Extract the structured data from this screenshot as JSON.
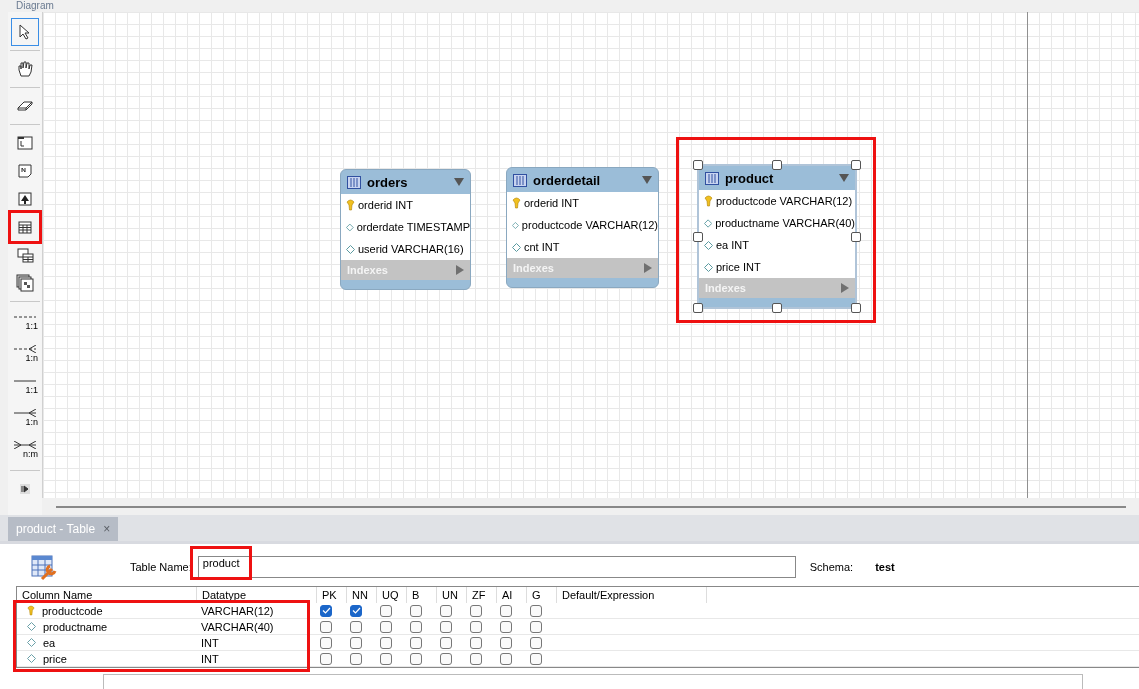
{
  "diagram": {
    "title": "Diagram"
  },
  "toolbar": [
    {
      "kind": "pointer",
      "selected": true,
      "highlighted": false
    },
    {
      "kind": "hand",
      "selected": false,
      "highlighted": false
    },
    {
      "kind": "eraser",
      "selected": false,
      "highlighted": false
    },
    {
      "kind": "layer",
      "selected": false,
      "highlighted": false
    },
    {
      "kind": "note",
      "selected": false,
      "highlighted": false
    },
    {
      "kind": "image",
      "selected": false,
      "highlighted": false
    },
    {
      "kind": "table",
      "selected": false,
      "highlighted": true
    },
    {
      "kind": "view",
      "selected": false,
      "highlighted": false
    },
    {
      "kind": "routine",
      "selected": false,
      "highlighted": false
    },
    {
      "kind": "relation",
      "dashed": true,
      "crow_right": false,
      "crow_left": false,
      "label": "1:1",
      "selected": false,
      "highlighted": false
    },
    {
      "kind": "relation",
      "dashed": true,
      "crow_right": true,
      "crow_left": false,
      "label": "1:n",
      "selected": false,
      "highlighted": false
    },
    {
      "kind": "relation",
      "dashed": false,
      "crow_right": false,
      "crow_left": false,
      "label": "1:1",
      "selected": false,
      "highlighted": false
    },
    {
      "kind": "relation",
      "dashed": false,
      "crow_right": true,
      "crow_left": false,
      "label": "1:n",
      "selected": false,
      "highlighted": false
    },
    {
      "kind": "relation",
      "dashed": false,
      "crow_right": true,
      "crow_left": true,
      "label": "n:m",
      "selected": false,
      "highlighted": false
    },
    {
      "kind": "more",
      "selected": false,
      "highlighted": false
    }
  ],
  "entities": [
    {
      "name": "orders",
      "selected": false,
      "highlighted": false,
      "indexes": "Indexes",
      "columns": [
        {
          "text": "orderid INT",
          "primary": true
        },
        {
          "text": "orderdate TIMESTAMP",
          "primary": false
        },
        {
          "text": "userid VARCHAR(16)",
          "primary": false
        }
      ]
    },
    {
      "name": "orderdetail",
      "selected": false,
      "highlighted": false,
      "indexes": "Indexes",
      "columns": [
        {
          "text": "orderid INT",
          "primary": true
        },
        {
          "text": "productcode VARCHAR(12)",
          "primary": false
        },
        {
          "text": "cnt INT",
          "primary": false
        }
      ]
    },
    {
      "name": "product",
      "selected": true,
      "highlighted": true,
      "indexes": "Indexes",
      "columns": [
        {
          "text": "productcode VARCHAR(12)",
          "primary": true
        },
        {
          "text": "productname VARCHAR(40)",
          "primary": false
        },
        {
          "text": "ea INT",
          "primary": false
        },
        {
          "text": "price INT",
          "primary": false
        }
      ]
    }
  ],
  "editor": {
    "tab": {
      "label": "product - Table",
      "close": "×",
      "selected": true
    },
    "table_name_label": "Table Name:",
    "table_name": "product",
    "table_name_highlighted": true,
    "schema_label": "Schema:",
    "schema": "test",
    "columns": [
      "Column Name",
      "Datatype",
      "PK",
      "NN",
      "UQ",
      "B",
      "UN",
      "ZF",
      "AI",
      "G",
      "Default/Expression"
    ],
    "rows_highlighted": true,
    "rows": [
      {
        "name": "productcode",
        "primary": true,
        "datatype": "VARCHAR(12)",
        "flags": [
          true,
          true,
          false,
          false,
          false,
          false,
          false,
          false
        ]
      },
      {
        "name": "productname",
        "primary": false,
        "datatype": "VARCHAR(40)",
        "flags": [
          false,
          false,
          false,
          false,
          false,
          false,
          false,
          false
        ]
      },
      {
        "name": "ea",
        "primary": false,
        "datatype": "INT",
        "flags": [
          false,
          false,
          false,
          false,
          false,
          false,
          false,
          false
        ]
      },
      {
        "name": "price",
        "primary": false,
        "datatype": "INT",
        "flags": [
          false,
          false,
          false,
          false,
          false,
          false,
          false,
          false
        ]
      }
    ]
  }
}
